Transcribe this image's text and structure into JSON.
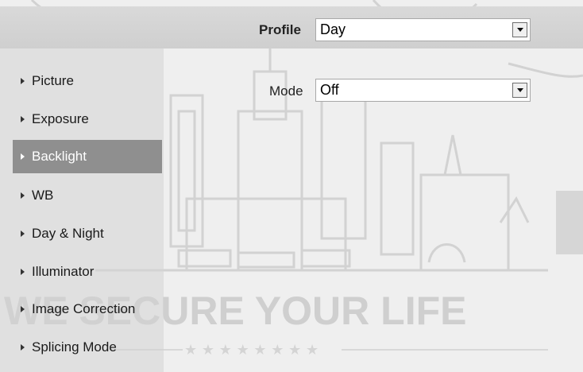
{
  "header": {
    "profile_label": "Profile",
    "profile_select": {
      "value": "Day"
    }
  },
  "sidebar": {
    "items": [
      {
        "label": "Picture"
      },
      {
        "label": "Exposure"
      },
      {
        "label": "Backlight"
      },
      {
        "label": "WB"
      },
      {
        "label": "Day & Night"
      },
      {
        "label": "Illuminator"
      },
      {
        "label": "Image Correction"
      },
      {
        "label": "Splicing Mode"
      }
    ],
    "active_index": 2
  },
  "main": {
    "mode_label": "Mode",
    "mode_select": {
      "value": "Off"
    }
  },
  "watermark": {
    "text": "WE SECURE YOUR LIFE"
  },
  "colors": {
    "active_item": "#8f8f8f",
    "header_bar": "#d4d4d4",
    "watermark": "#cdcdcd"
  }
}
